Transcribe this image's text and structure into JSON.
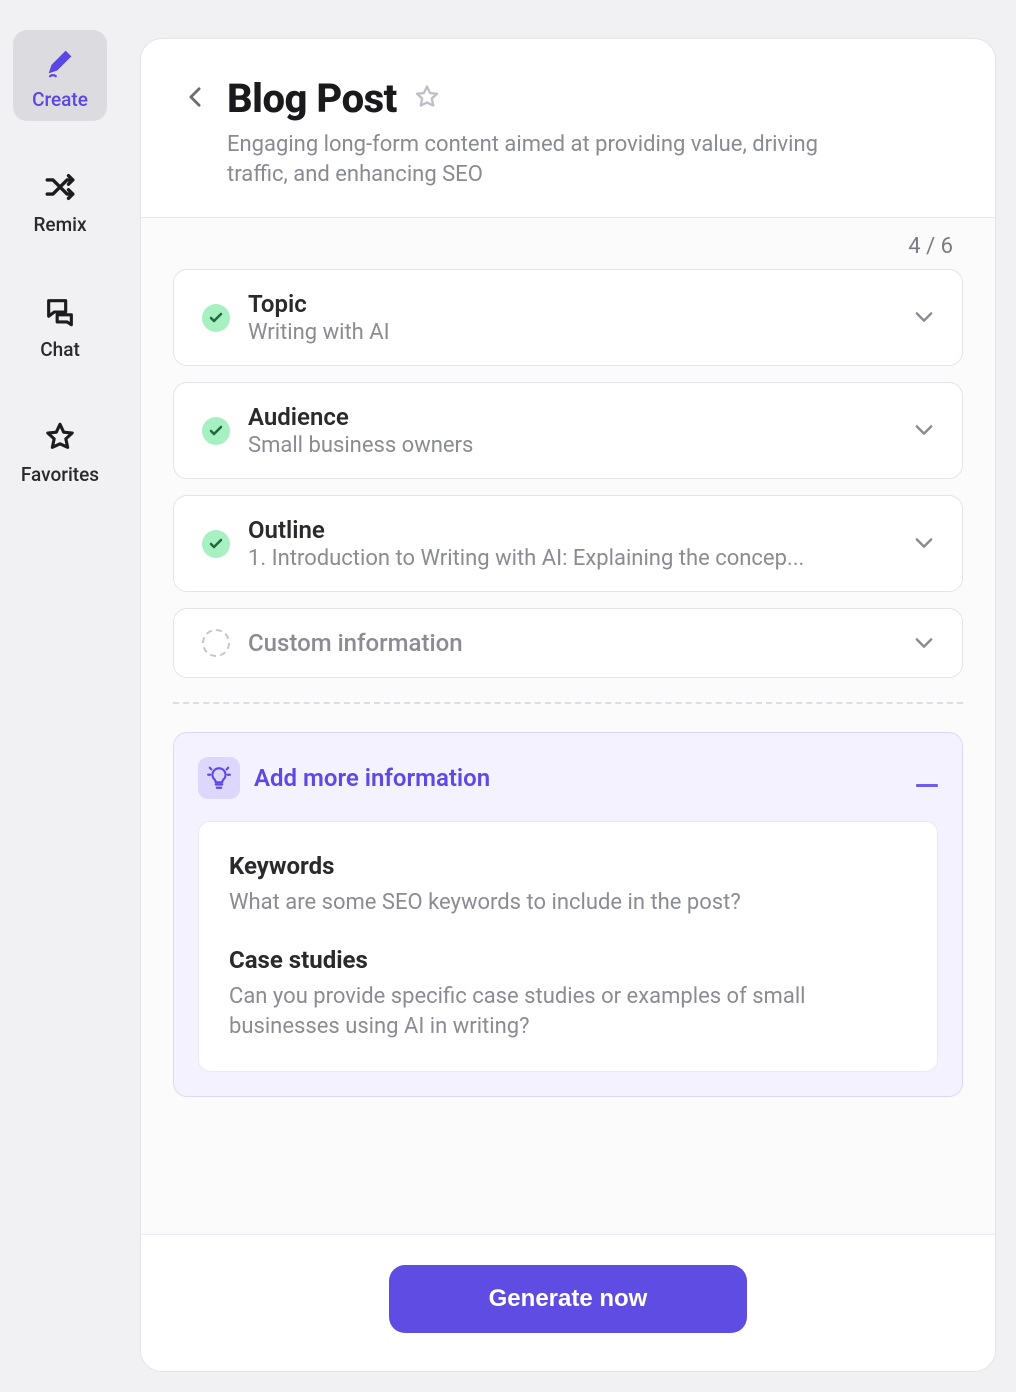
{
  "sidebar": {
    "items": [
      {
        "label": "Create",
        "icon": "pen"
      },
      {
        "label": "Remix",
        "icon": "shuffle"
      },
      {
        "label": "Chat",
        "icon": "chat"
      },
      {
        "label": "Favorites",
        "icon": "star"
      }
    ]
  },
  "header": {
    "title": "Blog Post",
    "subtitle": "Engaging long-form content aimed at providing value, driving traffic, and enhancing SEO"
  },
  "progress": "4 / 6",
  "sections": [
    {
      "title": "Topic",
      "value": "Writing with AI",
      "completed": true
    },
    {
      "title": "Audience",
      "value": "Small business owners",
      "completed": true
    },
    {
      "title": "Outline",
      "value": "1. Introduction to Writing with AI: Explaining the concep...",
      "completed": true
    },
    {
      "title": "Custom information",
      "value": "",
      "completed": false
    }
  ],
  "more": {
    "title": "Add more information",
    "items": [
      {
        "title": "Keywords",
        "desc": "What are some SEO keywords to include in the post?"
      },
      {
        "title": "Case studies",
        "desc": "Can you provide specific case studies or examples of small businesses using AI in writing?"
      }
    ]
  },
  "footer": {
    "generate_label": "Generate now"
  }
}
